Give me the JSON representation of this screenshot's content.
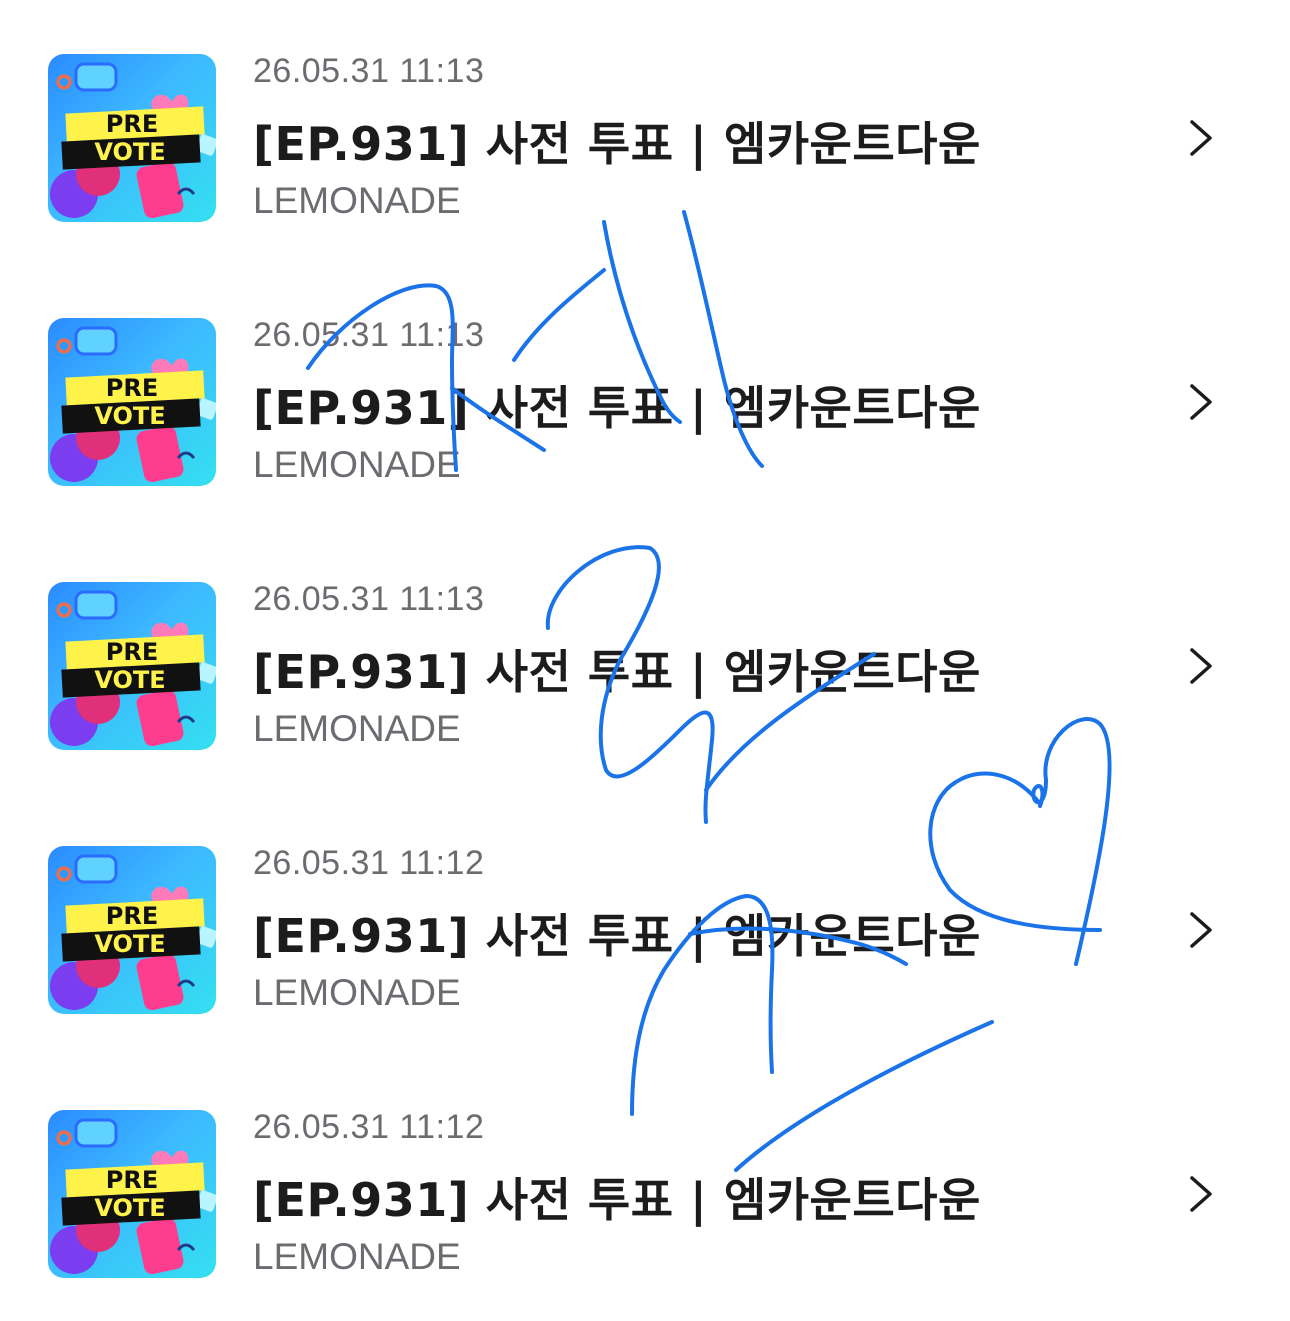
{
  "items": [
    {
      "timestamp": "26.05.31 11:13",
      "title": "[EP.931] 사전 투표 | 엠카운트다운",
      "artist": "LEMONADE",
      "thumb": {
        "line1": "PRE",
        "line2": "VOTE"
      }
    },
    {
      "timestamp": "26.05.31 11:13",
      "title": "[EP.931] 사전 투표 | 엠카운트다운",
      "artist": "LEMONADE",
      "thumb": {
        "line1": "PRE",
        "line2": "VOTE"
      }
    },
    {
      "timestamp": "26.05.31 11:13",
      "title": "[EP.931] 사전 투표 | 엠카운트다운",
      "artist": "LEMONADE",
      "thumb": {
        "line1": "PRE",
        "line2": "VOTE"
      }
    },
    {
      "timestamp": "26.05.31 11:12",
      "title": "[EP.931] 사전 투표 | 엠카운트다운",
      "artist": "LEMONADE",
      "thumb": {
        "line1": "PRE",
        "line2": "VOTE"
      }
    },
    {
      "timestamp": "26.05.31 11:12",
      "title": "[EP.931] 사전 투표 | 엠카운트다운",
      "artist": "LEMONADE",
      "thumb": {
        "line1": "PRE",
        "line2": "VOTE"
      }
    }
  ],
  "icons": {
    "chevron": "chevron-right-icon"
  },
  "colors": {
    "scribble": "#1a73e8",
    "text_primary": "#1c1c1e",
    "text_secondary": "#6b6b70"
  }
}
